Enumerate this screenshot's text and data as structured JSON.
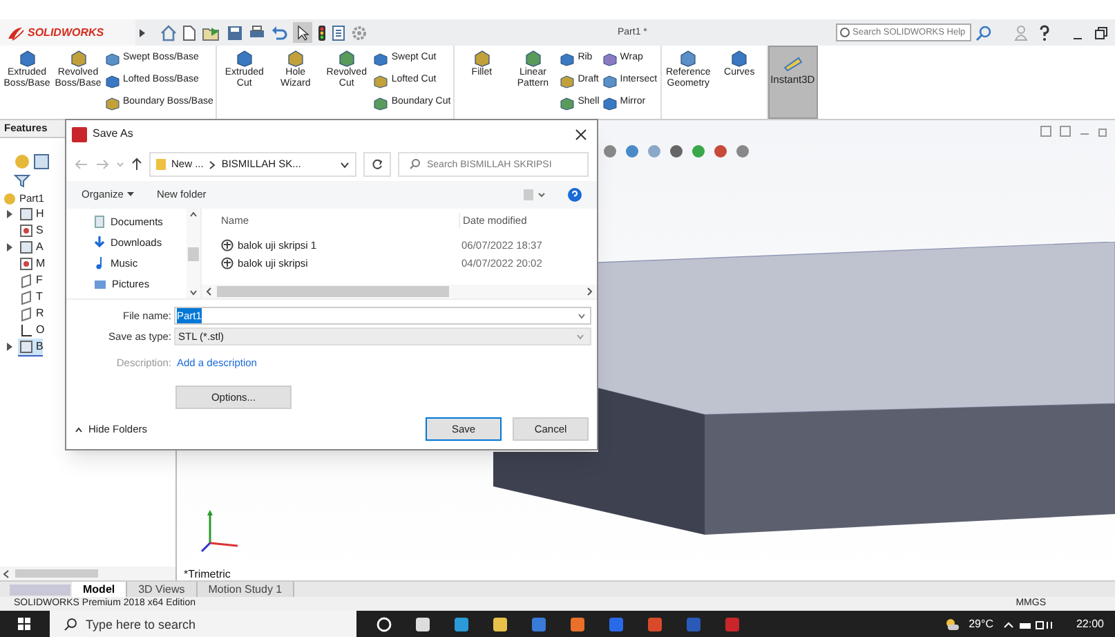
{
  "app": {
    "logo": "SOLIDWORKS",
    "document_title": "Part1 *",
    "help_search": {
      "placeholder": "Search SOLIDWORKS Help"
    }
  },
  "ribbon": {
    "groups": [
      [
        {
          "label": "Extruded Boss/Base",
          "kind": "large"
        },
        {
          "label": "Revolved Boss/Base",
          "kind": "large"
        },
        {
          "label": "Swept Boss/Base",
          "kind": "small"
        },
        {
          "label": "Lofted Boss/Base",
          "kind": "small"
        },
        {
          "label": "Boundary Boss/Base",
          "kind": "small"
        }
      ],
      [
        {
          "label": "Extruded Cut",
          "kind": "large"
        },
        {
          "label": "Hole Wizard",
          "kind": "large"
        },
        {
          "label": "Revolved Cut",
          "kind": "large"
        },
        {
          "label": "Swept Cut",
          "kind": "small"
        },
        {
          "label": "Lofted Cut",
          "kind": "small"
        },
        {
          "label": "Boundary Cut",
          "kind": "small"
        }
      ],
      [
        {
          "label": "Fillet",
          "kind": "large"
        },
        {
          "label": "Linear Pattern",
          "kind": "large"
        },
        {
          "label": "Rib",
          "kind": "small"
        },
        {
          "label": "Draft",
          "kind": "small"
        },
        {
          "label": "Shell",
          "kind": "small"
        },
        {
          "label": "Wrap",
          "kind": "small"
        },
        {
          "label": "Intersect",
          "kind": "small"
        },
        {
          "label": "Mirror",
          "kind": "small"
        }
      ],
      [
        {
          "label": "Reference Geometry",
          "kind": "large"
        },
        {
          "label": "Curves",
          "kind": "large"
        }
      ]
    ],
    "instant3d": {
      "label": "Instant3D",
      "pressed": true
    }
  },
  "feature_manager": {
    "tab": "Features",
    "tree": [
      {
        "label": "Part1",
        "kind": "part",
        "selected": false,
        "children": [
          {
            "label": "H",
            "kind": "group",
            "selected": false
          },
          {
            "label": "S",
            "kind": "item",
            "selected": false
          },
          {
            "label": "A",
            "kind": "group",
            "selected": false
          },
          {
            "label": "M",
            "kind": "item",
            "selected": false
          },
          {
            "label": "F",
            "kind": "plane",
            "selected": false
          },
          {
            "label": "T",
            "kind": "plane",
            "selected": false
          },
          {
            "label": "R",
            "kind": "plane",
            "selected": false
          },
          {
            "label": "O",
            "kind": "origin",
            "selected": false
          },
          {
            "label": "B",
            "kind": "group",
            "selected": true
          }
        ]
      }
    ]
  },
  "viewport": {
    "view_name": "*Trimetric"
  },
  "bottom_tabs": [
    {
      "label": "Model",
      "selected": true
    },
    {
      "label": "3D Views",
      "selected": false
    },
    {
      "label": "Motion Study 1",
      "selected": false
    }
  ],
  "status_bar": {
    "edition": "SOLIDWORKS Premium 2018 x64 Edition",
    "units": "MMGS"
  },
  "taskbar": {
    "search": {
      "placeholder": "Type here to search"
    },
    "weather": "29°C",
    "time": "22:00"
  },
  "dialog": {
    "title": "Save As",
    "breadcrumb": [
      "New ...",
      "BISMILLAH SK..."
    ],
    "search": {
      "placeholder": "Search BISMILLAH SKRIPSI"
    },
    "organize": "Organize",
    "new_folder": "New folder",
    "nav_items": [
      {
        "label": "Documents",
        "kind": "documents"
      },
      {
        "label": "Downloads",
        "kind": "downloads"
      },
      {
        "label": "Music",
        "kind": "music"
      },
      {
        "label": "Pictures",
        "kind": "pictures"
      }
    ],
    "columns": [
      "Name",
      "Date modified"
    ],
    "files": [
      {
        "name": "balok uji skripsi 1",
        "date": "06/07/2022 18:37"
      },
      {
        "name": "balok uji skripsi",
        "date": "04/07/2022 20:02"
      }
    ],
    "file_name": {
      "label": "File name:",
      "value": "Part1",
      "text_selected": true
    },
    "save_as_type": {
      "label": "Save as type:",
      "value": "STL (*.stl)"
    },
    "description": {
      "label": "Description:",
      "link": "Add a description"
    },
    "options_button": "Options...",
    "hide_folders": "Hide Folders",
    "buttons": [
      {
        "label": "Save",
        "default": true
      },
      {
        "label": "Cancel",
        "default": false
      }
    ]
  }
}
